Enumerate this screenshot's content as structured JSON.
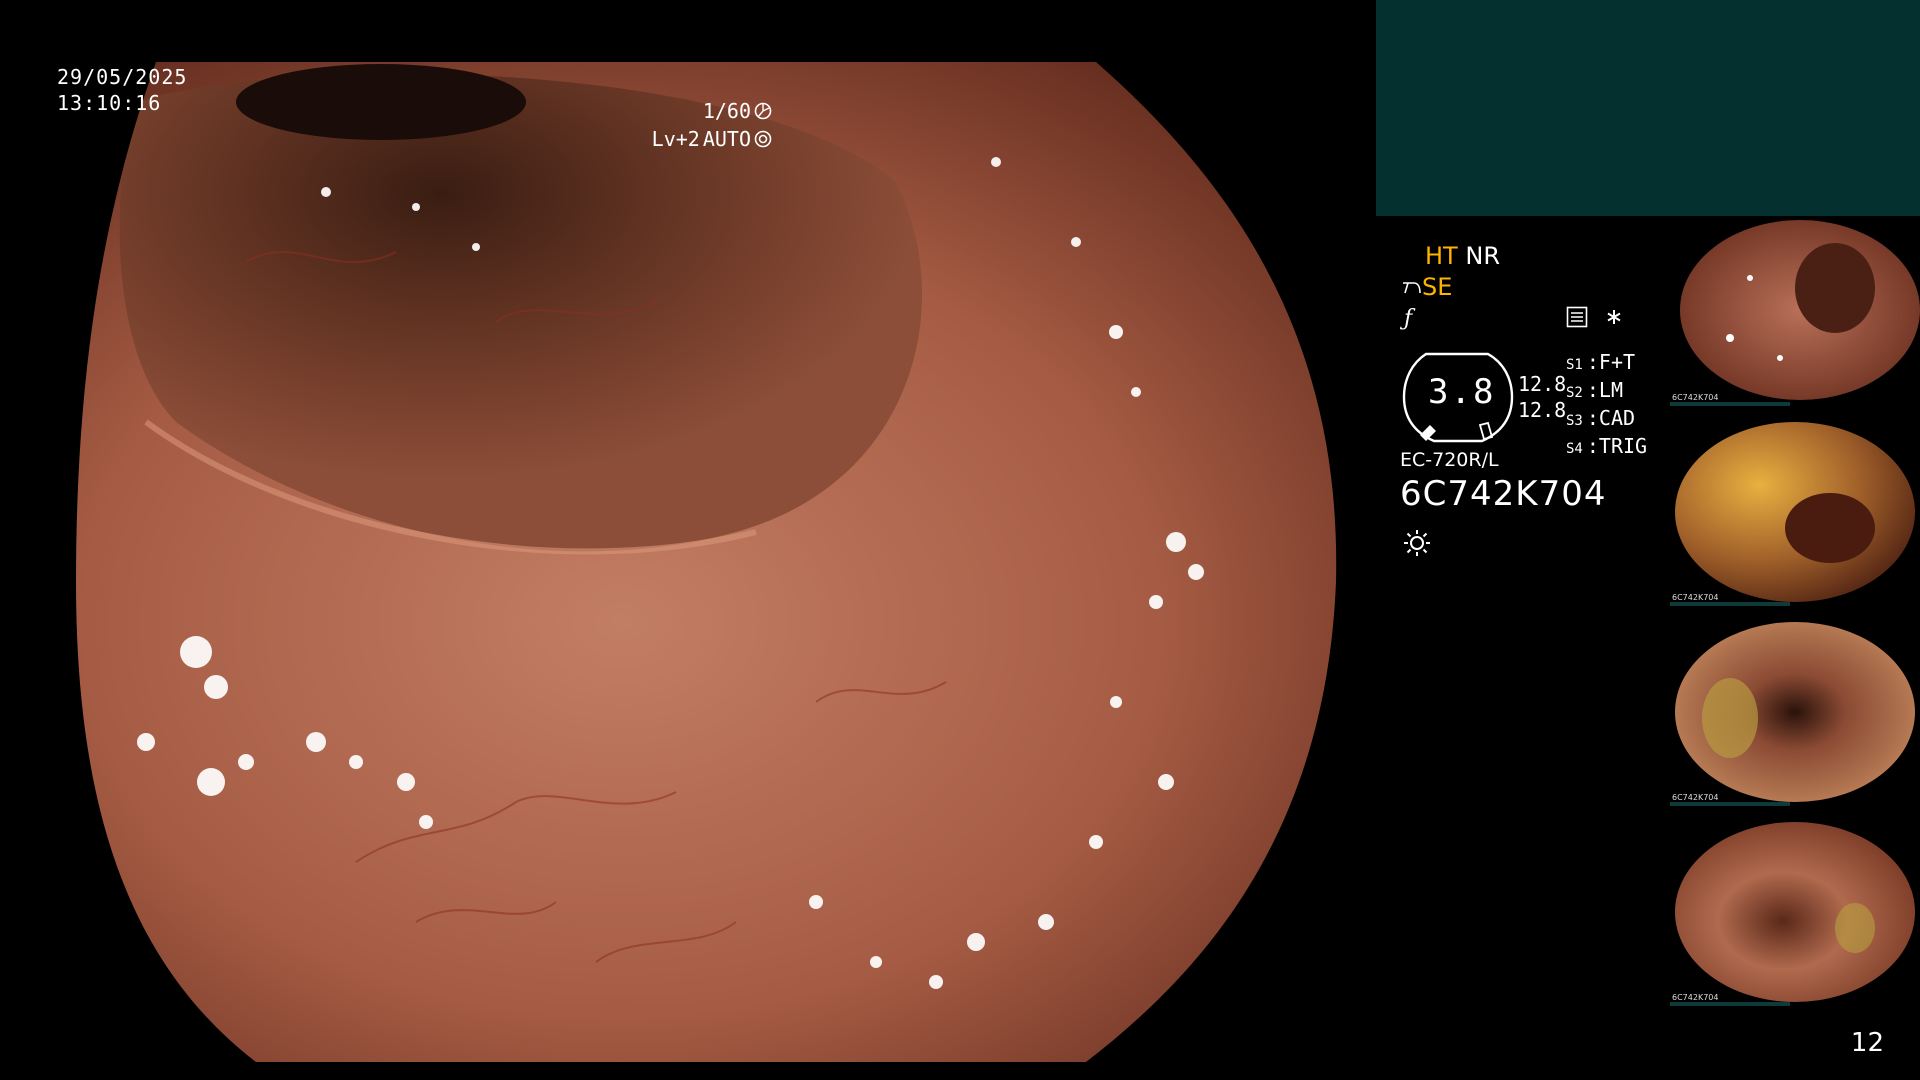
{
  "overlay": {
    "date": "29/05/2025",
    "time": "13:10:16",
    "shutter": "1/60",
    "level": "Lv+2",
    "iris": "AUTO"
  },
  "settings": {
    "ht": "HT",
    "nr": "NR",
    "se": "SE",
    "gauge_value": "3.8",
    "size_top": "12.8",
    "size_bottom": "12.8",
    "modes": [
      {
        "key": "S1",
        "value": "F+T"
      },
      {
        "key": "S2",
        "value": "LM"
      },
      {
        "key": "S3",
        "value": "CAD"
      },
      {
        "key": "S4",
        "value": "TRIG"
      }
    ],
    "scope_model": "EC-720R/L",
    "serial": "6C742K704"
  },
  "thumbnails": [
    {
      "tag": "6C742K704"
    },
    {
      "tag": "6C742K704"
    },
    {
      "tag": "6C742K704"
    },
    {
      "tag": "6C742K704"
    }
  ],
  "footer": {
    "page_number": "12"
  },
  "colors": {
    "accent": "#ffb400",
    "panel": "#043030",
    "tissue": "#b46a52"
  }
}
